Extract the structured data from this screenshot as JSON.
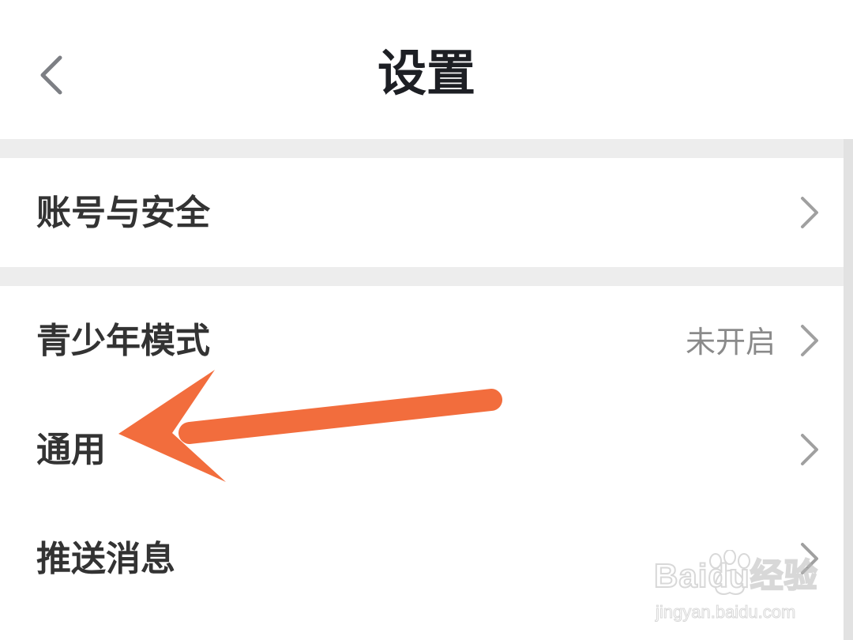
{
  "header": {
    "title": "设置",
    "back_icon": "chevron-left-icon"
  },
  "settings": {
    "items": [
      {
        "label": "账号与安全",
        "value": "",
        "icon": "chevron-right-icon"
      },
      {
        "label": "青少年模式",
        "value": "未开启",
        "icon": "chevron-right-icon"
      },
      {
        "label": "通用",
        "value": "",
        "icon": "chevron-right-icon"
      },
      {
        "label": "推送消息",
        "value": "",
        "icon": "chevron-right-icon"
      }
    ]
  },
  "annotation": {
    "icon": "arrow-pointer-icon",
    "color": "#f26d3d"
  },
  "watermark": {
    "logo_text": "Baidu经验",
    "url": "jingyan.baidu.com"
  },
  "colors": {
    "title_text": "#1d1f24",
    "label_text": "#333333",
    "value_text": "#8a8a8a",
    "chevron": "#a0a0a0",
    "divider": "#ededed"
  }
}
